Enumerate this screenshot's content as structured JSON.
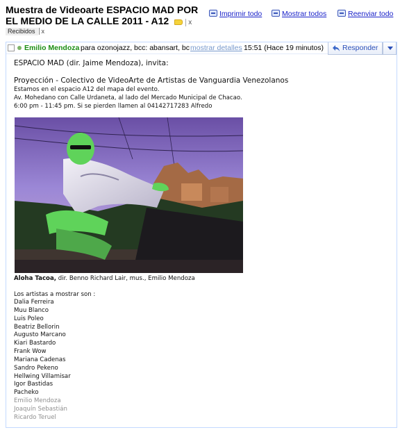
{
  "subject": {
    "title": "Muestra de Videoarte ESPACIO MAD POR EL MEDIO DE LA CALLE 2011 - A12",
    "label_icon": "label-tag-icon",
    "remove_label": "x"
  },
  "labels": {
    "inbox": "Recibidos",
    "remove": "x"
  },
  "actions": {
    "print": "Imprimir todo",
    "expand": "Mostrar todos",
    "forward": "Reenviar todo"
  },
  "header": {
    "sender": "Emilio Mendoza",
    "recipients": "para ozonojazz, bcc: abansart, bc",
    "show_details": "mostrar detalles",
    "time": "15:51 (Hace 19 minutos)",
    "reply": "Responder"
  },
  "body": {
    "invite": "ESPACIO MAD (dir. Jaime Mendoza), invita:",
    "project_title": "Proyección - Colectivo de VideoArte de Artistas de Vanguardia Venezolanos",
    "location": "Estamos en el espacio A12 del mapa del evento.",
    "address": "Av. Mohedano con Calle Urdaneta, al lado del Mercado Municipal de Chacao.",
    "schedule": "6:00 pm - 11:45 pm.  Si se pierden llamen al 04142717283 Alfredo",
    "caption_bold": "Aloha Tacoa,",
    "caption_rest": " dir. Benno Richard Lair, mus., Emilio Mendoza",
    "artists_intro": "Los artistas a mostrar son :",
    "artists": [
      "Dalia Ferreira",
      "Muu Blanco",
      "Luis Poleo",
      "Beatriz Bellorin",
      "Augusto Marcano",
      "Kiari Bastardo",
      "Frank Wow",
      "Mariana Cadenas",
      "Sandro Pekeno",
      "Hellwing Villamisar",
      "Igor Bastidas",
      "Pacheko",
      "Emilio Mendoza",
      "Joaquín Sebastián",
      "Ricardo Teruel"
    ],
    "gray_from_index": 12
  },
  "colors": {
    "link": "#1a22c9",
    "sender": "#1a8d12",
    "box_border": "#c3d9ff"
  }
}
